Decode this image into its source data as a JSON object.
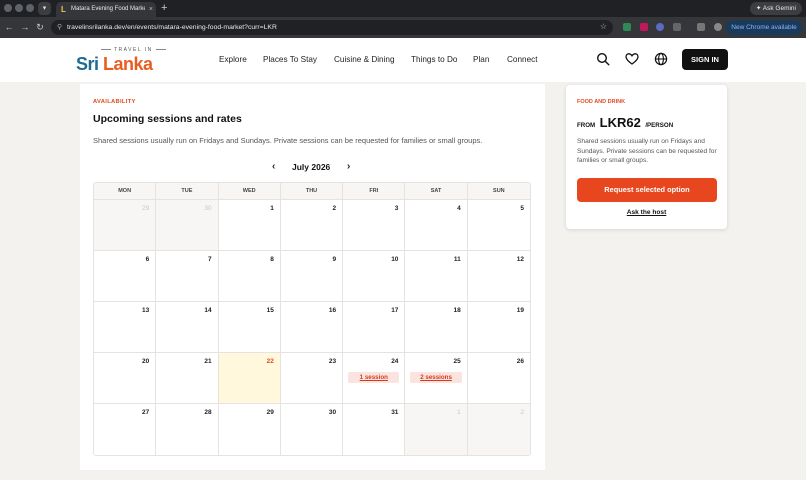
{
  "browser": {
    "tab_title": "Matara Evening Food Market",
    "tab_close": "×",
    "new_tab": "+",
    "url": "travelinsrilanka.dev/en/events/matara-evening-food-market?curr=LKR",
    "ask_gemini": "Ask Gemini",
    "update_button": "New Chrome available"
  },
  "header": {
    "logo_tagline": "TRAVEL IN",
    "logo_sri": "Sri",
    "logo_lanka": "Lanka",
    "nav": [
      "Explore",
      "Places To Stay",
      "Cuisine & Dining",
      "Things to Do",
      "Plan",
      "Connect"
    ],
    "signin_label": "SIGN IN",
    "icons": [
      "search-icon",
      "heart-icon",
      "globe-icon"
    ]
  },
  "availability": {
    "eyebrow": "AVAILABILITY",
    "title": "Upcoming sessions and rates",
    "description": "Shared sessions usually run on Fridays and Sundays. Private sessions can be requested for families or small groups.",
    "month_label": "July 2026",
    "prev_label": "‹",
    "next_label": "›",
    "weekdays": [
      "MON",
      "TUE",
      "WED",
      "THU",
      "FRI",
      "SAT",
      "SUN"
    ],
    "days": [
      {
        "num": "29",
        "other": true
      },
      {
        "num": "30",
        "other": true
      },
      {
        "num": "1"
      },
      {
        "num": "2"
      },
      {
        "num": "3"
      },
      {
        "num": "4"
      },
      {
        "num": "5"
      },
      {
        "num": "6"
      },
      {
        "num": "7"
      },
      {
        "num": "8"
      },
      {
        "num": "9"
      },
      {
        "num": "10"
      },
      {
        "num": "11"
      },
      {
        "num": "12"
      },
      {
        "num": "13"
      },
      {
        "num": "14"
      },
      {
        "num": "15"
      },
      {
        "num": "16"
      },
      {
        "num": "17"
      },
      {
        "num": "18"
      },
      {
        "num": "19"
      },
      {
        "num": "20"
      },
      {
        "num": "21"
      },
      {
        "num": "22",
        "today": true
      },
      {
        "num": "23"
      },
      {
        "num": "24",
        "session": "1 session"
      },
      {
        "num": "25",
        "session": "2 sessions"
      },
      {
        "num": "26"
      },
      {
        "num": "27"
      },
      {
        "num": "28"
      },
      {
        "num": "29"
      },
      {
        "num": "30"
      },
      {
        "num": "31"
      },
      {
        "num": "1",
        "other": true
      },
      {
        "num": "2",
        "other": true
      }
    ]
  },
  "booking": {
    "eyebrow": "FOOD AND DRINK",
    "price_from": "FROM",
    "price_amount": "LKR62",
    "price_unit": "/PERSON",
    "description": "Shared sessions usually run on Fridays and Sundays. Private sessions can be requested for families or small groups.",
    "request_label": "Request selected option",
    "ask_host_label": "Ask the host"
  },
  "colors": {
    "accent": "#e8461e",
    "brand_blue": "#1f6b8f",
    "today_bg": "#fff8dc",
    "session_bg": "#fbe3df"
  }
}
